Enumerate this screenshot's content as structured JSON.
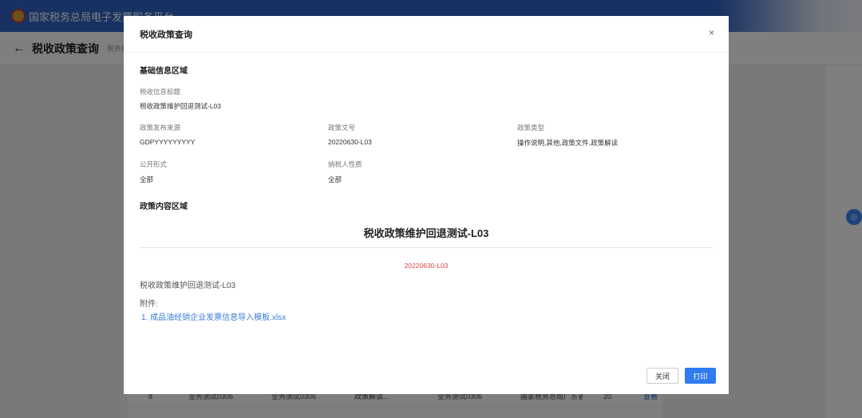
{
  "app": {
    "title": "国家税务总局电子发票服务平台",
    "page_title": "税收政策查询",
    "breadcrumb": "税务数",
    "back_arrow": "←"
  },
  "background_table": {
    "rows": [
      [
        "8",
        "业务测试0306",
        "业务测试0306",
        "政策解读...",
        "业务测试0306",
        "国家税务总局广东省...",
        "20",
        "查看"
      ],
      [
        "",
        "",
        "",
        "",
        "",
        "",
        "",
        ""
      ]
    ]
  },
  "float_button": {
    "icon": "headset-icon",
    "glyph": "◎"
  },
  "modal": {
    "title": "税收政策查询",
    "close_glyph": "×",
    "basic_section_title": "基础信息区域",
    "fields": {
      "info_title_label": "税收信息标题",
      "info_title_value": "税收政策维护回退测试-L03",
      "source_label": "政策发布来源",
      "source_value": "GDPYYYYYYYYY",
      "doc_no_label": "政策文号",
      "doc_no_value": "20220630-L03",
      "type_label": "政策类型",
      "type_value": "操作说明,其他,政策文件,政策解读",
      "public_form_label": "公开形式",
      "public_form_value": "全部",
      "taxpayer_label": "纳税人性质",
      "taxpayer_value": "全部"
    },
    "content_section_title": "政策内容区域",
    "document": {
      "title": "税收政策维护回退测试-L03",
      "number": "20220630-L03",
      "body": "税收政策维护回退测试-L03",
      "attachment_label": "附件:",
      "attachment_link": "1. 成品油经销企业发票信息导入模板.xlsx"
    },
    "buttons": {
      "close": "关闭",
      "print": "打印"
    }
  },
  "colors": {
    "brand_blue": "#2f64c4",
    "primary_button": "#2f7bf0",
    "link": "#3a7bd5",
    "doc_number_red": "#e04747"
  }
}
